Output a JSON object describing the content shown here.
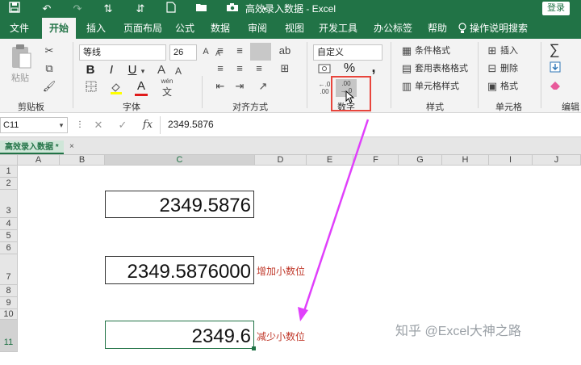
{
  "window": {
    "title": "高效录入数据 - Excel",
    "login_label": "登录"
  },
  "quick_access": [
    "save-icon",
    "undo-icon",
    "redo-icon",
    "sort-icon",
    "sort-desc-icon",
    "new-file-icon",
    "open-folder-icon",
    "camera-icon",
    "more-icon"
  ],
  "tabs": [
    {
      "label": "文件"
    },
    {
      "label": "开始",
      "active": true
    },
    {
      "label": "插入"
    },
    {
      "label": "页面布局"
    },
    {
      "label": "公式"
    },
    {
      "label": "数据"
    },
    {
      "label": "审阅"
    },
    {
      "label": "视图"
    },
    {
      "label": "开发工具"
    },
    {
      "label": "办公标签"
    },
    {
      "label": "帮助"
    },
    {
      "label": "操作说明搜索"
    }
  ],
  "ribbon": {
    "clipboard": {
      "paste_label": "粘贴",
      "group_label": "剪贴板"
    },
    "font": {
      "font_name": "等线",
      "font_size": "26",
      "group_label": "字体",
      "bold": "B",
      "italic": "I",
      "underline": "U",
      "wen": "wén",
      "wen_char": "文",
      "font_color_char": "A"
    },
    "alignment": {
      "group_label": "对齐方式"
    },
    "number": {
      "format": "自定义",
      "group_label": "数字",
      "percent": "%",
      "comma": ",",
      "inc_decimal_top": "←.0",
      "inc_decimal_bottom": ".00",
      "dec_decimal_top": ".00",
      "dec_decimal_bottom": "→.0"
    },
    "styles": {
      "conditional": "条件格式",
      "table_format": "套用表格格式",
      "cell_style": "单元格样式",
      "group_label": "样式"
    },
    "cells": {
      "insert": "插入",
      "delete": "删除",
      "format": "格式",
      "group_label": "单元格"
    },
    "editing": {
      "group_label": "编辑",
      "sum_char": "∑"
    }
  },
  "formula_bar": {
    "name_box": "C11",
    "fx": "fx",
    "value": "2349.5876"
  },
  "sheet": {
    "tab_name": "高效录入数据 *",
    "columns": [
      "A",
      "B",
      "C",
      "D",
      "E",
      "F",
      "G",
      "H",
      "I",
      "J"
    ],
    "rows": [
      "1",
      "2",
      "3",
      "4",
      "5",
      "6",
      "7",
      "8",
      "9",
      "10",
      "11"
    ],
    "cells": {
      "c3": "2349.5876",
      "c7": "2349.5876000",
      "c11": "2349.6"
    },
    "annotations": {
      "d7": "增加小数位",
      "d11": "减少小数位"
    }
  },
  "watermark": "知乎 @Excel大神之路",
  "colors": {
    "accent": "#217346",
    "highlight": "#e8453c",
    "arrow": "#e040fb",
    "annotation": "#c0392b"
  }
}
